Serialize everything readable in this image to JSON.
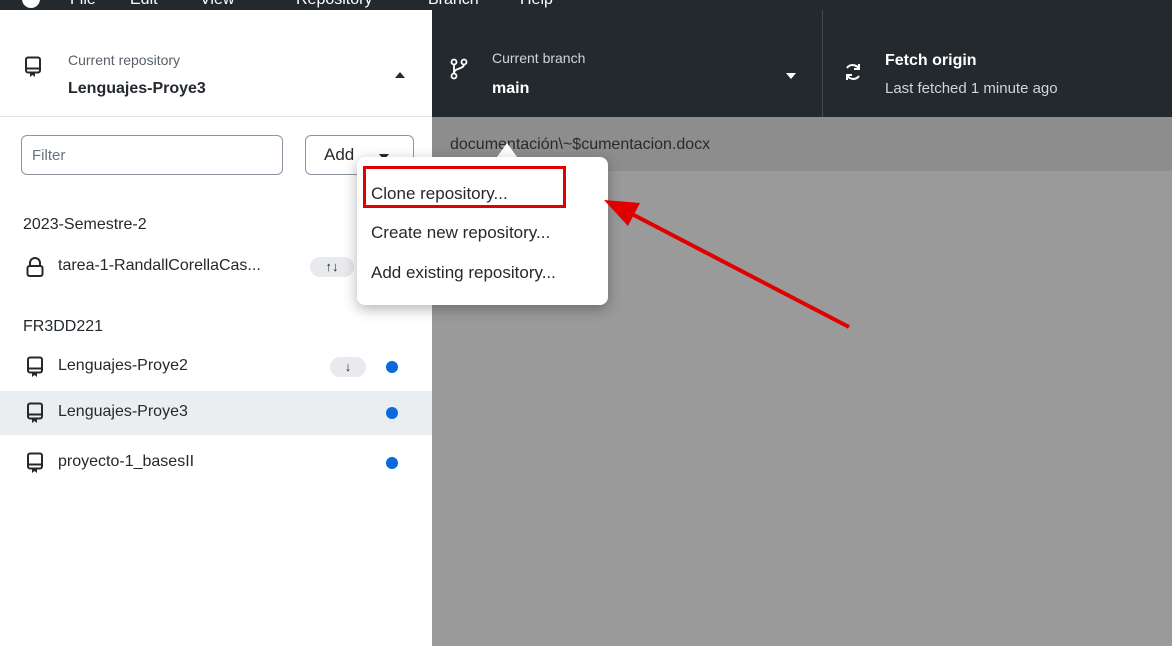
{
  "menubar": {
    "items": [
      "File",
      "Edit",
      "View",
      "Repository",
      "Branch",
      "Help"
    ]
  },
  "repository": {
    "label": "Current repository",
    "name": "Lenguajes-Proye3"
  },
  "branch": {
    "label": "Current branch",
    "name": "main"
  },
  "fetch": {
    "title": "Fetch origin",
    "subtitle": "Last fetched 1 minute ago"
  },
  "sidebar": {
    "filter_placeholder": "Filter",
    "add_label": "Add",
    "groups": [
      {
        "name": "2023-Semestre-2",
        "repos": [
          {
            "name": "tarea-1-RandallCorellaCas...",
            "icon": "lock-icon",
            "sync": "↑↓"
          }
        ]
      },
      {
        "name": "FR3DD221",
        "repos": [
          {
            "name": "Lenguajes-Proye2",
            "icon": "repo-icon",
            "sync": "↓",
            "changes": true
          },
          {
            "name": "Lenguajes-Proye3",
            "icon": "repo-icon",
            "selected": true,
            "changes": true
          },
          {
            "name": "proyecto-1_basesII",
            "icon": "repo-icon",
            "changes": true
          }
        ]
      }
    ]
  },
  "main": {
    "file_path": "documentación\\~$cumentacion.docx"
  },
  "add_menu": {
    "items": [
      "Clone repository...",
      "Create new repository...",
      "Add existing repository..."
    ]
  },
  "colors": {
    "toolbar_bg": "#24292e",
    "accent_blue": "#0969da",
    "highlight_red": "#e00000",
    "overlay_gray": "#9a9a9a"
  }
}
